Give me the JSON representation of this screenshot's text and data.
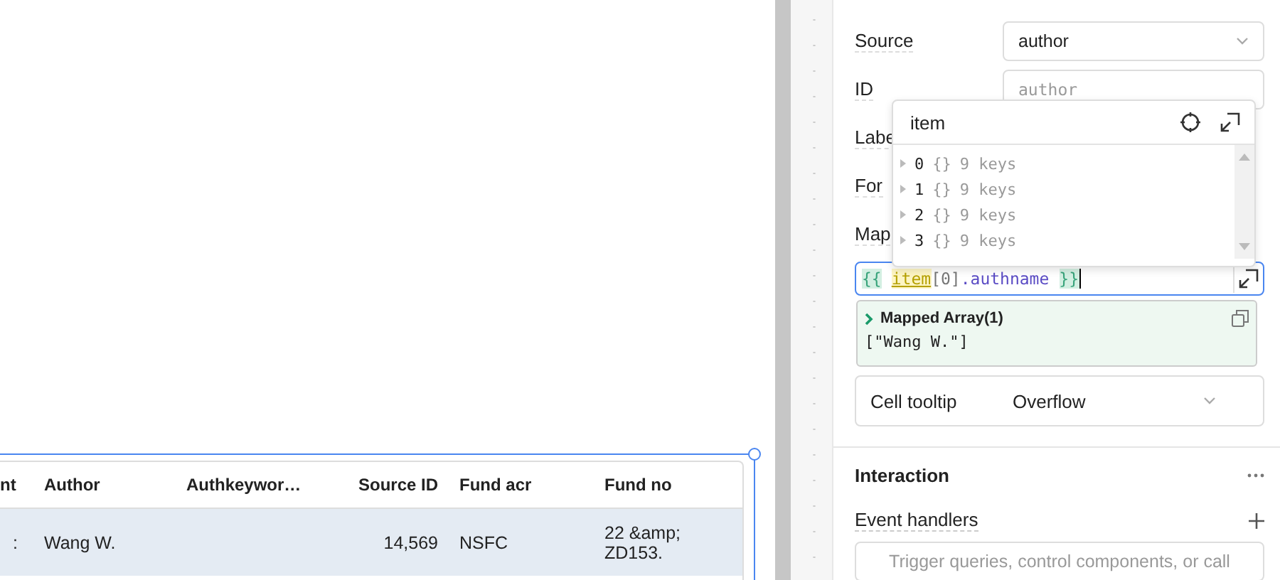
{
  "table": {
    "columns": [
      "nt",
      "Author",
      "Authkeywor…",
      "Source ID",
      "Fund acr",
      "Fund no"
    ],
    "rows": [
      {
        "cells": [
          ":",
          "Wang W.",
          "",
          "14,569",
          "NSFC",
          "22 &amp; ZD153."
        ],
        "selected": true
      }
    ]
  },
  "inspector": {
    "fields": [
      {
        "label": "Source",
        "kind": "select",
        "value": "author"
      },
      {
        "label": "ID",
        "kind": "input",
        "placeholder": "author"
      },
      {
        "label": "Labe",
        "kind": "none"
      },
      {
        "label": "For",
        "kind": "none"
      },
      {
        "label": "Map",
        "kind": "none"
      }
    ],
    "code": [
      {
        "text": "{{",
        "kind": "brace"
      },
      {
        "text": "item",
        "kind": "var"
      },
      {
        "text": "[0]",
        "kind": "punct"
      },
      {
        "text": ".authname",
        "kind": "prop"
      },
      {
        "text": "}}",
        "kind": "brace"
      }
    ],
    "popup": {
      "title": "item",
      "rows": [
        {
          "key": "0",
          "type": "{}",
          "count": "9 keys"
        },
        {
          "key": "1",
          "type": "{}",
          "count": "9 keys"
        },
        {
          "key": "2",
          "type": "{}",
          "count": "9 keys"
        },
        {
          "key": "3",
          "type": "{}",
          "count": "9 keys"
        }
      ]
    },
    "result": {
      "title": "Mapped Array(1)",
      "value": "[\"Wang W.\"]"
    },
    "tooltip": {
      "label": "Cell tooltip",
      "value": "Overflow"
    },
    "interaction": {
      "title": "Interaction",
      "event_label": "Event handlers",
      "event_placeholder": "Trigger queries, control components, or call"
    }
  }
}
